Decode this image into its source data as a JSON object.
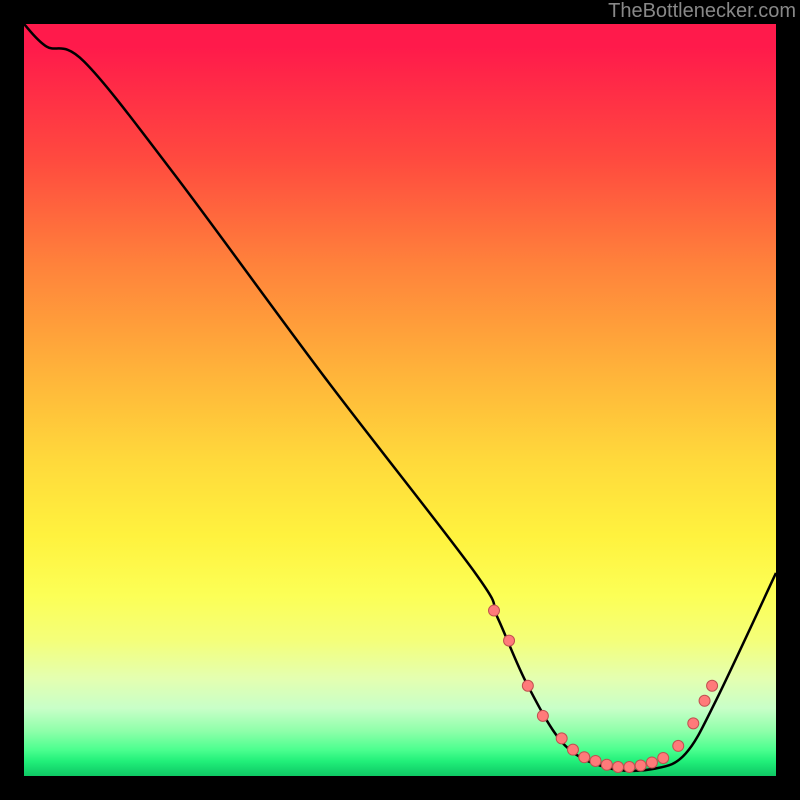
{
  "attribution": "TheBottlenecker.com",
  "chart_data": {
    "type": "line",
    "title": "",
    "xlabel": "",
    "ylabel": "",
    "xlim": [
      0,
      100
    ],
    "ylim": [
      0,
      100
    ],
    "series": [
      {
        "name": "curve",
        "x": [
          0,
          3,
          8,
          20,
          40,
          60,
          63,
          67,
          72,
          78,
          84,
          88,
          92,
          100
        ],
        "y": [
          100,
          97,
          95,
          80,
          53,
          27,
          21,
          12,
          4,
          1,
          1,
          3,
          10,
          27
        ]
      }
    ],
    "markers": {
      "name": "dots",
      "x": [
        62.5,
        64.5,
        67,
        69,
        71.5,
        73,
        74.5,
        76,
        77.5,
        79,
        80.5,
        82,
        83.5,
        85,
        87,
        89,
        90.5,
        91.5
      ],
      "y": [
        22,
        18,
        12,
        8,
        5,
        3.5,
        2.5,
        2,
        1.5,
        1.2,
        1.2,
        1.4,
        1.8,
        2.4,
        4,
        7,
        10,
        12
      ]
    },
    "colors": {
      "line": "#000000",
      "marker_fill": "#ff7a7a",
      "marker_stroke": "#c05050"
    }
  }
}
